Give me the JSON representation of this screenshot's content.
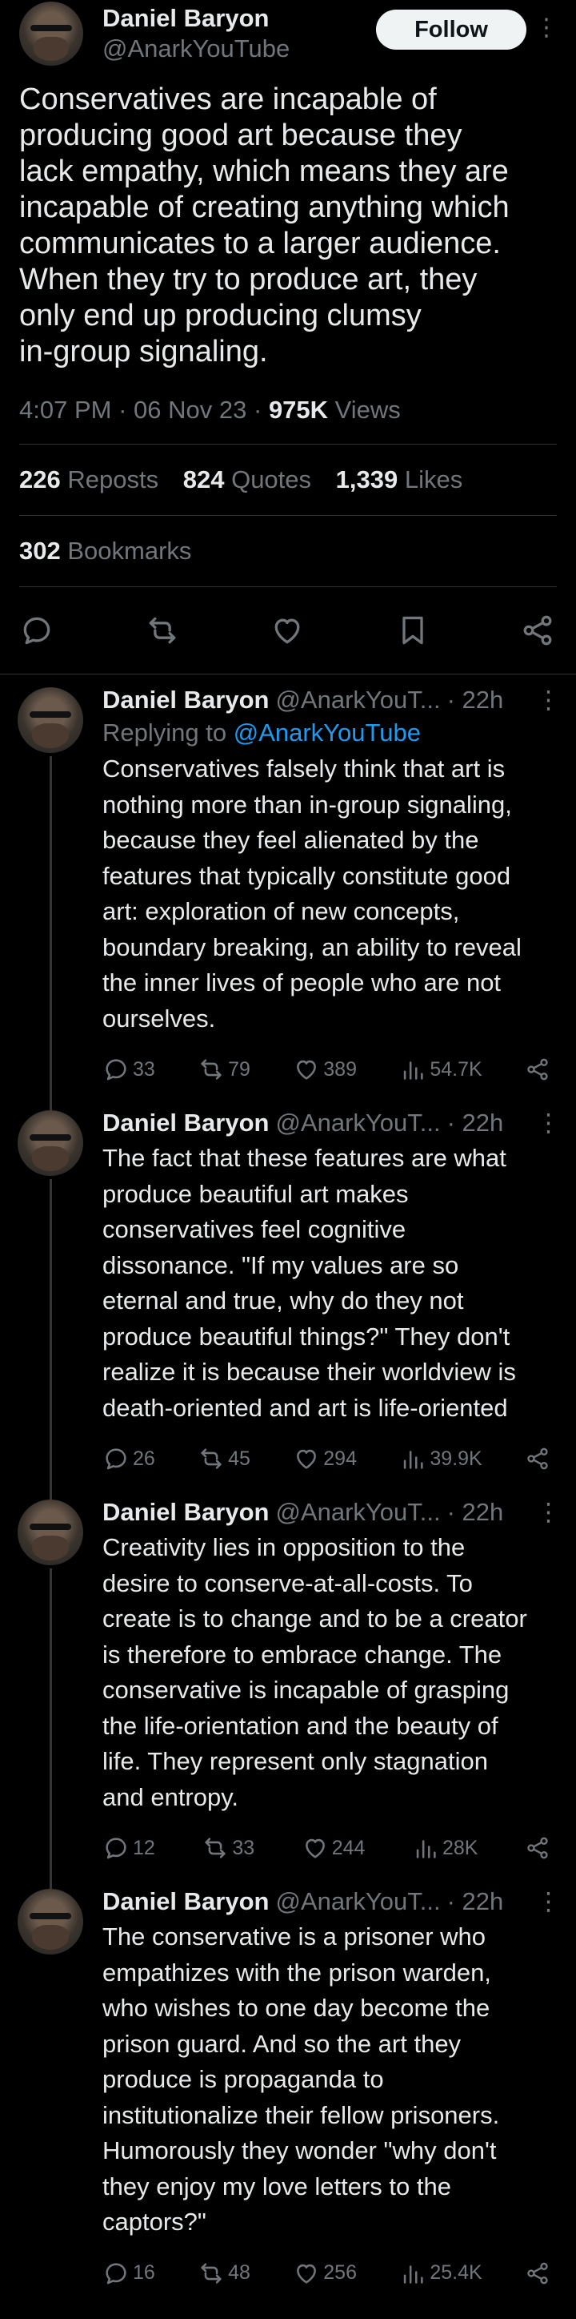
{
  "main_tweet": {
    "author_name": "Daniel Baryon",
    "handle": "@AnarkYouTube",
    "follow_label": "Follow",
    "more_icon": "⋮",
    "text": "Conservatives are incapable of\nproducing good art because they\nlack empathy, which means they are\nincapable of creating anything which\ncommunicates to a larger audience.\nWhen they try to produce art, they\nonly end up producing clumsy\nin-group signaling.",
    "time": "4:07 PM",
    "date": "06 Nov 23",
    "views_count": "975K",
    "views_label": "Views",
    "separator": "·",
    "reposts_count": "226",
    "reposts_label": "Reposts",
    "quotes_count": "824",
    "quotes_label": "Quotes",
    "likes_count": "1,339",
    "likes_label": "Likes",
    "bookmarks_count": "302",
    "bookmarks_label": "Bookmarks",
    "action_icons": [
      "reply-icon",
      "repost-icon",
      "like-icon",
      "bookmark-icon",
      "share-icon"
    ]
  },
  "replies": [
    {
      "author_name": "Daniel Baryon",
      "handle": "@AnarkYouT...",
      "age": "· 22h",
      "more_icon": "⋮",
      "replying_prefix": "Replying to ",
      "replying_to": "@AnarkYouTube",
      "text": "Conservatives falsely think that art is\nnothing more than in-group signaling,\nbecause they feel alienated by the\nfeatures that typically constitute good\nart: exploration of new concepts,\nboundary breaking, an ability to reveal\nthe inner lives of people who are not\nourselves.",
      "replies": "33",
      "reposts": "79",
      "likes": "389",
      "views": "54.7K"
    },
    {
      "author_name": "Daniel Baryon",
      "handle": "@AnarkYouT...",
      "age": "· 22h",
      "more_icon": "⋮",
      "text": "The fact that these features are what\nproduce beautiful art makes\nconservatives feel cognitive\ndissonance. \"If my values are so\neternal and true, why do they not\nproduce beautiful things?\" They don't\nrealize it is because their worldview is\ndeath-oriented and art is life-oriented",
      "replies": "26",
      "reposts": "45",
      "likes": "294",
      "views": "39.9K"
    },
    {
      "author_name": "Daniel Baryon",
      "handle": "@AnarkYouT...",
      "age": "· 22h",
      "more_icon": "⋮",
      "text": "Creativity lies in opposition to the\ndesire to conserve-at-all-costs. To\ncreate is to change and to be a creator\nis therefore to embrace change. The\nconservative is incapable of grasping\nthe life-orientation and the beauty of\nlife. They represent only stagnation\nand entropy.",
      "replies": "12",
      "reposts": "33",
      "likes": "244",
      "views": "28K"
    },
    {
      "author_name": "Daniel Baryon",
      "handle": "@AnarkYouT...",
      "age": "· 22h",
      "more_icon": "⋮",
      "text": "The conservative is a prisoner who\nempathizes with the prison warden,\nwho wishes to one day become the\nprison guard. And so the art they\nproduce is propaganda to\ninstitutionalize their fellow prisoners.\nHumorously they wonder \"why don't\nthey enjoy my love letters to the\ncaptors?\"",
      "replies": "16",
      "reposts": "48",
      "likes": "256",
      "views": "25.4K"
    }
  ],
  "colors": {
    "background": "#000000",
    "text_primary": "#e7e9ea",
    "text_secondary": "#71767b",
    "link": "#1d9bf0",
    "divider": "#2f3336",
    "follow_bg": "#eff3f4"
  }
}
